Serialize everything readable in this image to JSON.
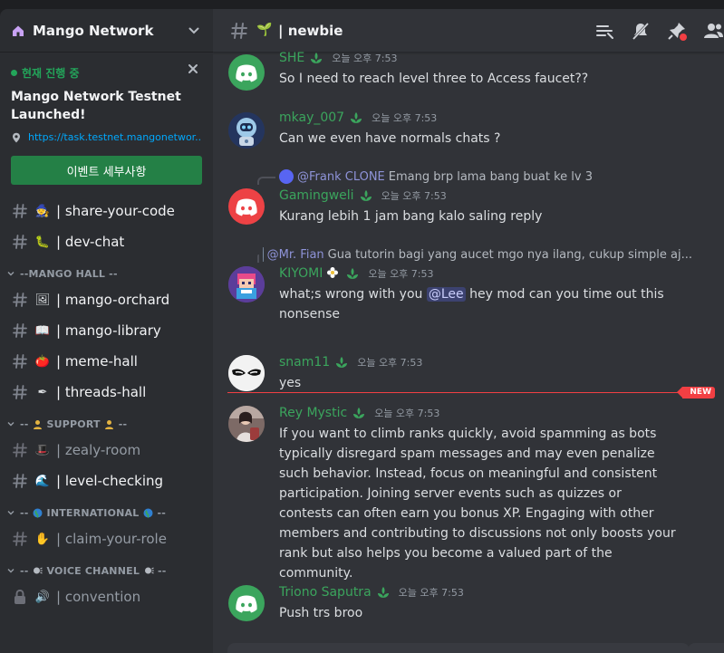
{
  "server": {
    "name": "Mango Network"
  },
  "event": {
    "status": "현재 진행 중",
    "title": "Mango Network Testnet Launched!",
    "link": "https://task.testnet.mangonetwor...",
    "button": "이벤트 세부사항"
  },
  "sidebar": {
    "channels_top": [
      {
        "emoji": "🧙",
        "name": "| share-your-code"
      },
      {
        "emoji": "🐛",
        "name": "| dev-chat"
      }
    ],
    "cat_mango": "--MANGO HALL --",
    "mango_hall": [
      {
        "emoji": "🖼",
        "name": "| mango-orchard"
      },
      {
        "emoji": "📖",
        "name": "| mango-library"
      },
      {
        "emoji": "🍅",
        "name": "| meme-hall"
      },
      {
        "emoji": "✒",
        "name": "| threads-hall"
      }
    ],
    "cat_support_pre": "--",
    "cat_support": "SUPPORT",
    "cat_support_post": "--",
    "support": [
      {
        "emoji": "🎩",
        "name": "| zealy-room"
      },
      {
        "emoji": "🌊",
        "name": "| level-checking"
      }
    ],
    "cat_intl_pre": "--",
    "cat_intl": "INTERNATIONAL",
    "cat_intl_post": "--",
    "international": [
      {
        "emoji": "✋",
        "name": "| claim-your-role"
      }
    ],
    "cat_voice_pre": "--",
    "cat_voice": "VOICE CHANNEL",
    "cat_voice_post": "--",
    "voice": [
      {
        "emoji": "🔊",
        "name": "| convention"
      }
    ]
  },
  "channel": {
    "emoji": "🌱",
    "name": "| newbie"
  },
  "messages": [
    {
      "user": "SHE",
      "time": "오늘 오후 7:53",
      "text": "So I need to reach level three to Access faucet??",
      "avatar": "discord"
    },
    {
      "user": "mkay_007",
      "time": "오늘 오후 7:53",
      "text": "Can we even have normals chats ?",
      "avatar": "robot"
    },
    {
      "user": "Gamingweli",
      "time": "오늘 오후 7:53",
      "text": "Kurang lebih 1 jam bang kalo saling reply",
      "avatar": "discord-red",
      "reply_name": "@Frank CLONE",
      "reply_text": "Emang brp lama bang buat ke lv 3"
    },
    {
      "user": "KIYOMI",
      "time": "오늘 오후 7:53",
      "text_a": "what;s wrong with you ",
      "mention": "@Lee",
      "text_b": " hey mod can you time out this nonsense",
      "avatar": "pixel",
      "reply_name": "@Mr. Fian",
      "reply_text": "Gua tutorin bagi yang aucet mgo nya ilang, cukup simple aj..."
    },
    {
      "user": "snam11",
      "time": "오늘 오후 7:53",
      "text": "yes",
      "avatar": "mask"
    },
    {
      "user": "Rey Mystic",
      "time": "오늘 오후 7:53",
      "text": "If you want to climb ranks quickly, avoid spamming as bots typically disregard spam messages and may even penalize such behavior. Instead, focus on meaningful and consistent participation. Joining server events such as quizzes or contests can often earn you bonus XP. Engaging with other members and contributing to discussions not only boosts your rank but also helps you become a valued part of the community.",
      "avatar": "photo"
    },
    {
      "user": "Triono Saputra",
      "time": "오늘 오후 7:53",
      "text": "Push trs broo",
      "avatar": "discord-green"
    }
  ],
  "new_badge": "NEW"
}
